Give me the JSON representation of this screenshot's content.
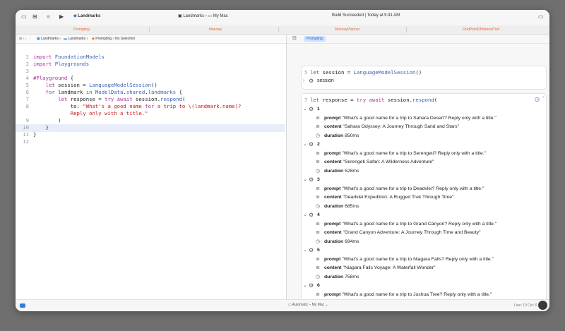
{
  "titlebar": {
    "scheme": "Landmarks",
    "destination_app": "Landmarks",
    "destination_device": "My Mac",
    "build_status": "Build Succeeded | Today at 9:41 AM"
  },
  "tabs": [
    "Prompting",
    "Itinerary",
    "ItineraryPlanner",
    "FindPointOfInterestTool"
  ],
  "breadcrumb": [
    "Landmarks",
    "Landmarks",
    "Prompting",
    "No Selection"
  ],
  "editor": {
    "lines": [
      {
        "n": "1",
        "code": "import FoundationModels"
      },
      {
        "n": "2",
        "code": "import Playgrounds"
      },
      {
        "n": "3",
        "code": ""
      },
      {
        "n": "4",
        "code": "#Playground {"
      },
      {
        "n": "5",
        "code": "    let session = LanguageModelSession()"
      },
      {
        "n": "6",
        "code": "    for landmark in ModelData.shared.landmarks {"
      },
      {
        "n": "7",
        "code": "        let response = try await session.respond("
      },
      {
        "n": "8",
        "code": "            to: \"What's a good name for a trip to \\(landmark.name)?"
      },
      {
        "n": "8b",
        "code": "            Reply only with a title.\""
      },
      {
        "n": "9",
        "code": "        )"
      },
      {
        "n": "10",
        "code": "    }"
      },
      {
        "n": "11",
        "code": "}"
      },
      {
        "n": "12",
        "code": ""
      }
    ]
  },
  "canvas": {
    "chip": "Prompting",
    "session_card": {
      "line_no": "5",
      "code": "let session = LanguageModelSession()",
      "label": "session"
    },
    "response_card": {
      "line_no": "7",
      "code": "let response = try await session.respond(",
      "results": [
        {
          "n": "1",
          "prompt": "\"What's a good name for a trip to Sahara Desert?  Reply only with a title.\"",
          "content": "\"Sahara Odyssey: A Journey Through Sand and Stars\"",
          "duration": "850ms"
        },
        {
          "n": "2",
          "prompt": "\"What's a good name for a trip to Serengeti?  Reply only with a title.\"",
          "content": "\"Serengeti Safari: A Wilderness Adventure\"",
          "duration": "528ms"
        },
        {
          "n": "3",
          "prompt": "\"What's a good name for a trip to Deadvlei?  Reply only with a title.\"",
          "content": "\"Deadvlei Expedition: A Rugged Trek Through Time\"",
          "duration": "685ms"
        },
        {
          "n": "4",
          "prompt": "\"What's a good name for a trip to Grand Canyon?  Reply only with a title.\"",
          "content": "\"Grand Canyon Adventure: A Journey Through Time and Beauty\"",
          "duration": "694ms"
        },
        {
          "n": "5",
          "prompt": "\"What's a good name for a trip to Niagara Falls?  Reply only with a title.\"",
          "content": "\"Niagara Falls Voyage: A Waterfall Wonder\"",
          "duration": "758ms"
        },
        {
          "n": "6",
          "prompt": "\"What's a good name for a trip to Joshua Tree?  Reply only with a title.\""
        }
      ]
    },
    "field_labels": {
      "prompt": "prompt",
      "content": "content",
      "duration": "duration"
    },
    "footer": "Automatic – My Mac"
  },
  "status": {
    "position": "Line: 10  Col: 6"
  }
}
